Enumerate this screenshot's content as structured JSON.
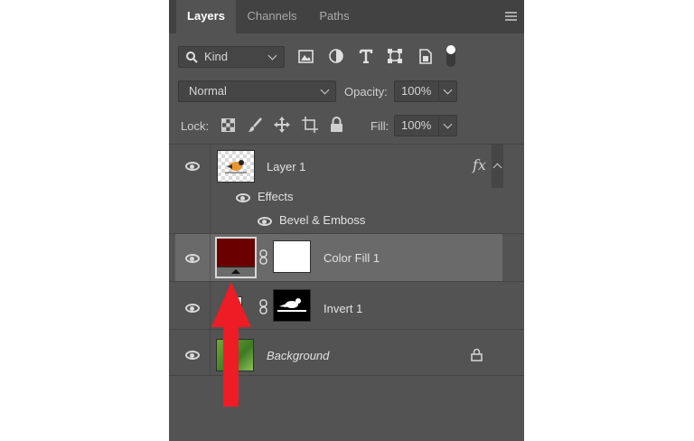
{
  "tabs": [
    "Layers",
    "Channels",
    "Paths"
  ],
  "filter": {
    "kind_label": "Kind"
  },
  "blend": {
    "mode": "Normal",
    "opacity_label": "Opacity:",
    "opacity_value": "100%"
  },
  "lock": {
    "label": "Lock:",
    "fill_label": "Fill:",
    "fill_value": "100%"
  },
  "layers": [
    {
      "name": "Layer 1",
      "fx": "fx",
      "effects_label": "Effects",
      "effect": "Bevel & Emboss"
    },
    {
      "name": "Color Fill 1",
      "fill_color": "#6b0000"
    },
    {
      "name": "Invert 1"
    },
    {
      "name": "Background"
    }
  ],
  "colors": {
    "panel": "#535353",
    "tabbar": "#424242",
    "selected_row": "#6a6a6a",
    "arrow": "#ee1c24"
  }
}
